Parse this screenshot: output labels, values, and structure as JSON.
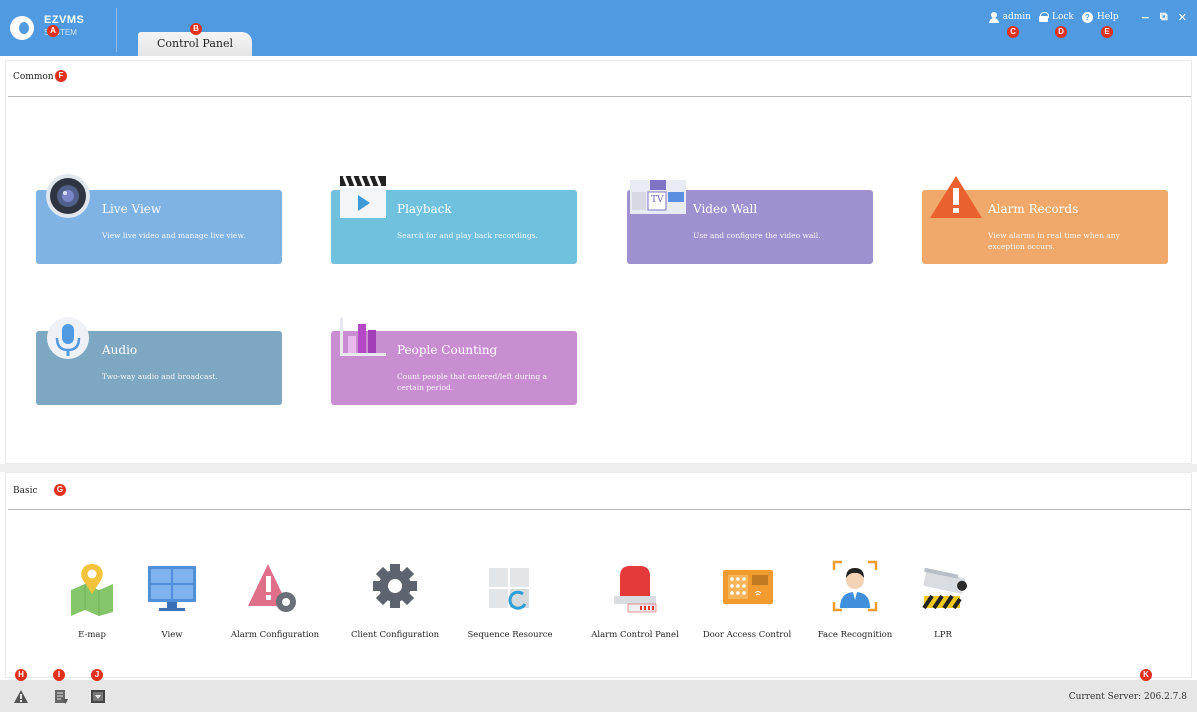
{
  "app": {
    "logo_line1": "EZVMS",
    "logo_line2": "SYSTEM"
  },
  "tabs": [
    {
      "label": "Control Panel"
    }
  ],
  "user_bar": {
    "user": "admin",
    "lock": "Lock",
    "help": "Help"
  },
  "window_controls": {
    "minimize": "−",
    "restore": "⧉",
    "close": "✕"
  },
  "common": {
    "title": "Common",
    "tiles": [
      {
        "title": "Live View",
        "desc": "View live video and manage live view.",
        "color": "#7fb3e3",
        "icon": "camera-icon"
      },
      {
        "title": "Playback",
        "desc": "Search for and play back recordings.",
        "color": "#6fc1de",
        "icon": "clapper-icon"
      },
      {
        "title": "Video Wall",
        "desc": "Use and configure the video wall.",
        "color": "#9f91cf",
        "icon": "video-wall-icon"
      },
      {
        "title": "Alarm Records",
        "desc": "View alarms in real time when any exception occurs.",
        "color": "#f0a96a",
        "icon": "alarm-warning-icon"
      },
      {
        "title": "Audio",
        "desc": "Two-way audio and broadcast.",
        "color": "#7ea7c2",
        "icon": "microphone-icon"
      },
      {
        "title": "People Counting",
        "desc": "Count people that entered/left during a certain period.",
        "color": "#c98ed2",
        "icon": "bar-chart-icon"
      }
    ]
  },
  "basic": {
    "title": "Basic",
    "items": [
      {
        "label": "E-map",
        "icon": "map-pin-icon"
      },
      {
        "label": "View",
        "icon": "monitor-grid-icon"
      },
      {
        "label": "Alarm Configuration",
        "icon": "alarm-gear-icon"
      },
      {
        "label": "Client Configuration",
        "icon": "gear-icon"
      },
      {
        "label": "Sequence Resource",
        "icon": "sequence-icon"
      },
      {
        "label": "Alarm Control Panel",
        "icon": "siren-icon"
      },
      {
        "label": "Door Access Control",
        "icon": "keypad-icon"
      },
      {
        "label": "Face Recognition",
        "icon": "face-scan-icon"
      },
      {
        "label": "LPR",
        "icon": "lpr-camera-icon"
      }
    ]
  },
  "badges": [
    "A",
    "B",
    "C",
    "D",
    "E",
    "F",
    "G",
    "H",
    "I",
    "J",
    "K"
  ],
  "status": {
    "server_label": "Current Server:",
    "server_ip": "206.2.7.8"
  }
}
